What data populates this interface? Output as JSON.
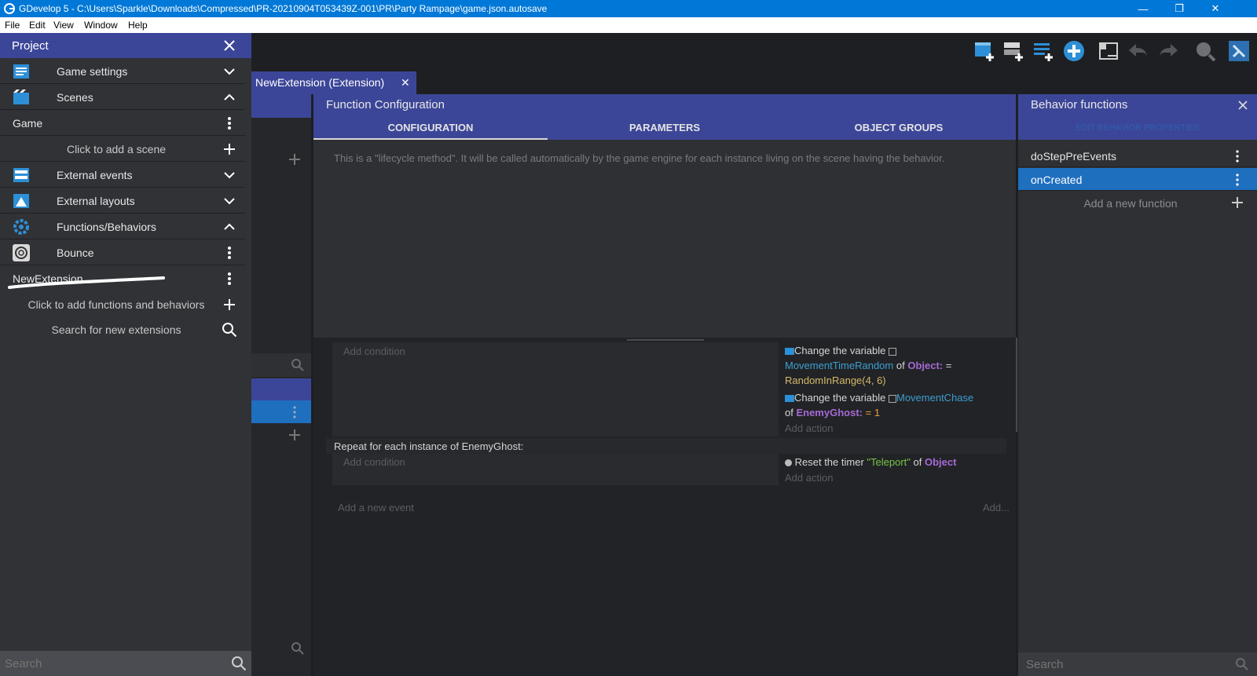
{
  "titlebar": {
    "title": "GDevelop 5 - C:\\Users\\Sparkle\\Downloads\\Compressed\\PR-20210904T053439Z-001\\PR\\Party Rampage\\game.json.autosave",
    "minimize": "—",
    "restore": "❐",
    "close": "✕"
  },
  "menubar": {
    "items": [
      "File",
      "Edit",
      "View",
      "Window",
      "Help"
    ]
  },
  "toolbar": {
    "icons": [
      "add-scene-icon",
      "add-object-icon",
      "add-layer-icon",
      "add-event-icon",
      "window-icon",
      "undo-icon",
      "redo-icon",
      "search-icon",
      "tools-icon"
    ]
  },
  "project": {
    "title": "Project",
    "rows": [
      {
        "label": "Game settings",
        "icon": "settings-icon"
      },
      {
        "label": "Scenes",
        "icon": "scenes-icon"
      },
      {
        "label": "Game"
      },
      {
        "label": "Click to add a scene"
      },
      {
        "label": "External events",
        "icon": "external-events-icon"
      },
      {
        "label": "External layouts",
        "icon": "external-layouts-icon"
      },
      {
        "label": "Functions/Behaviors",
        "icon": "gear-icon"
      },
      {
        "label": "Bounce",
        "icon": "bounce-icon"
      },
      {
        "label": "NewExtension"
      },
      {
        "label": "Click to add functions and behaviors"
      },
      {
        "label": "Search for new extensions"
      }
    ],
    "search_placeholder": "Search"
  },
  "editor": {
    "tab_label": "NewExtension (Extension)",
    "tab_close": "✕"
  },
  "function_config": {
    "title": "Function Configuration",
    "tabs": [
      "CONFIGURATION",
      "PARAMETERS",
      "OBJECT GROUPS"
    ],
    "active_tab": "CONFIGURATION",
    "note": "This is a \"lifecycle method\". It will be called automatically by the game engine for each instance living on the scene having the behavior."
  },
  "events": {
    "add_condition": "Add condition",
    "add_action": "Add action",
    "action1": {
      "prefix": "Change the variable",
      "var": "MovementTimeRandom",
      "of": "of",
      "obj": "Object:",
      "eq": "=",
      "val": "RandomInRange(4, 6)"
    },
    "action2": {
      "prefix": "Change the variable",
      "var": "MovementChase",
      "of": "of",
      "obj": "EnemyGhost:",
      "eq": "=",
      "val": "1"
    },
    "repeat_label": "Repeat for each instance of EnemyGhost:",
    "action3": {
      "prefix": "Reset the timer",
      "timer": "\"Teleport\"",
      "of": "of",
      "obj": "Object"
    },
    "add_new_event": "Add a new event",
    "add_more": "Add..."
  },
  "behavior_functions": {
    "title": "Behavior functions",
    "edit_props": "EDIT BEHAVIOR PROPERTIES",
    "functions": [
      "doStepPreEvents",
      "onCreated"
    ],
    "selected": "onCreated",
    "add_function": "Add a new function",
    "search_placeholder": "Search"
  },
  "colors": {
    "accent": "#3c4698",
    "selected": "#1f6fbf",
    "titlebar": "#0078d7",
    "panel": "#303236"
  }
}
